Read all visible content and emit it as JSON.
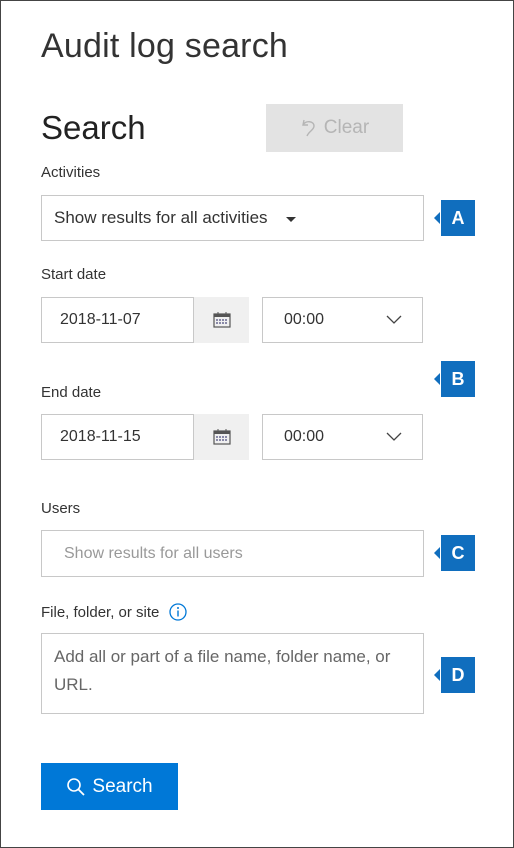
{
  "header": {
    "title": "Audit log search"
  },
  "search_section": {
    "title": "Search",
    "clear_label": "Clear",
    "clear_icon": "undo-icon"
  },
  "activities": {
    "label": "Activities",
    "value": "Show results for all activities",
    "icon": "caret-down-icon"
  },
  "start_date": {
    "label": "Start date",
    "date": "2018-11-07",
    "time": "00:00",
    "calendar_icon": "calendar-icon",
    "chevron_icon": "chevron-down-icon"
  },
  "end_date": {
    "label": "End date",
    "date": "2018-11-15",
    "time": "00:00",
    "calendar_icon": "calendar-icon",
    "chevron_icon": "chevron-down-icon"
  },
  "users": {
    "label": "Users",
    "placeholder": "Show results for all users"
  },
  "file_folder_site": {
    "label": "File, folder, or site",
    "placeholder": "Add all or part of a file name, folder name, or URL.",
    "info_icon": "info-icon"
  },
  "search_button": {
    "label": "Search",
    "icon": "search-icon"
  },
  "callouts": [
    {
      "letter": "A"
    },
    {
      "letter": "B"
    },
    {
      "letter": "C"
    },
    {
      "letter": "D"
    }
  ],
  "colors": {
    "accent": "#0078d7",
    "callout": "#106ebe",
    "disabled_bg": "#e3e3e3",
    "disabled_text": "#b5b5b5"
  }
}
